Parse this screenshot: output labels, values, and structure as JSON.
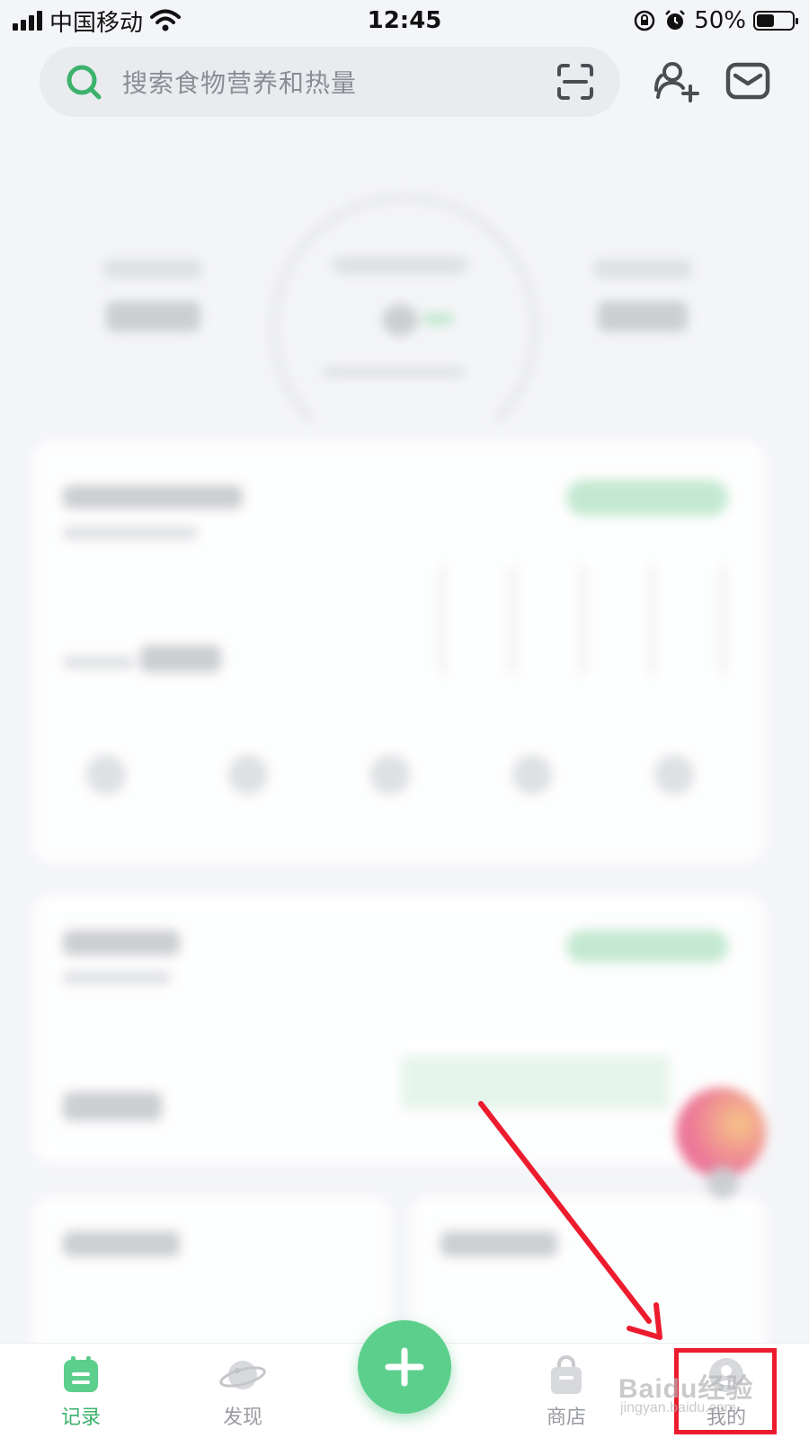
{
  "status_bar": {
    "carrier": "中国移动",
    "time": "12:45",
    "battery_percent": "50%",
    "battery_level": 0.5
  },
  "search": {
    "placeholder": "搜索食物营养和热量"
  },
  "bottom_nav": {
    "items": [
      {
        "label": "记录",
        "active": true
      },
      {
        "label": "发现",
        "active": false
      },
      {
        "label": "商店",
        "active": false
      },
      {
        "label": "我的",
        "active": false
      }
    ]
  },
  "watermark": {
    "brand": "Baidu经验",
    "url": "jingyan.baidu.com"
  },
  "colors": {
    "accent_green": "#3cb26c",
    "add_button": "#5ccf8d",
    "annotation_red": "#ec1b2e"
  },
  "icons": {
    "search": "search-icon",
    "scan": "scan-icon",
    "add_friend": "add-friend-icon",
    "mail": "mail-icon",
    "record": "calendar-icon",
    "discover": "planet-icon",
    "store": "shopping-bag-icon",
    "profile": "avatar-icon"
  }
}
